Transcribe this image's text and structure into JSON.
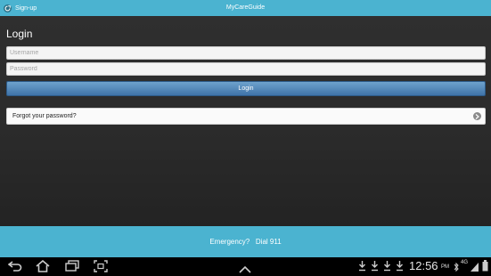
{
  "header": {
    "title": "MyCareGuide",
    "signup_label": "Sign-up"
  },
  "login": {
    "heading": "Login",
    "username_placeholder": "Username",
    "password_placeholder": "Password",
    "button_label": "Login",
    "forgot_label": "Forgot your password?"
  },
  "footer": {
    "emergency_text": "Emergency?   Dial 911"
  },
  "statusbar": {
    "time": "12:56",
    "ampm": "PM",
    "network": "4G"
  },
  "icons": {
    "signup": "signup-icon",
    "chevron": "chevron-right-icon",
    "back": "back-icon",
    "home": "home-icon",
    "recent": "recent-apps-icon",
    "screenshot": "screenshot-icon",
    "up": "up-arrow-icon",
    "download": "download-icon",
    "bluetooth": "bluetooth-icon",
    "signal": "signal-icon",
    "battery": "battery-icon"
  },
  "colors": {
    "accent": "#4bb3d0",
    "button": "#4f84b8",
    "background": "#2b2b2b"
  }
}
